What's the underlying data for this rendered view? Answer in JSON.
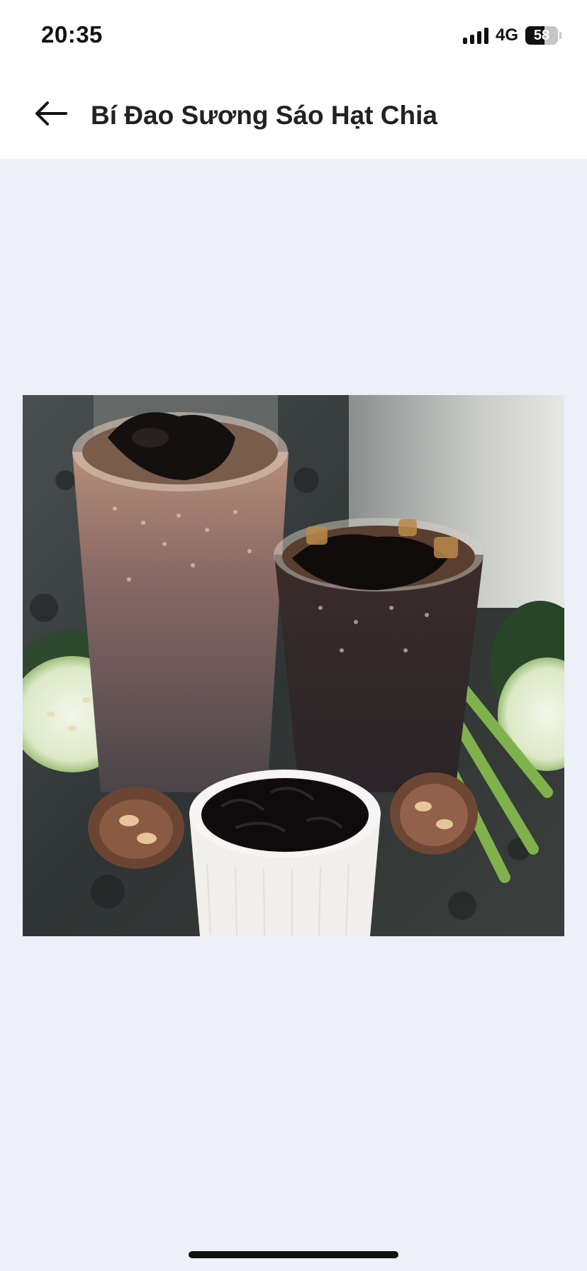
{
  "status_bar": {
    "time": "20:35",
    "network": "4G",
    "battery_level": "58",
    "battery_fraction": 0.58,
    "icons": [
      "signal-icon",
      "battery-icon"
    ]
  },
  "nav": {
    "back_icon": "arrow-left-icon",
    "title": "Bí Đao Sương Sáo Hạt Chia"
  },
  "content": {
    "image_subject": "product-photo"
  },
  "colors": {
    "page_background": "#edf0f8",
    "header_background": "#ffffff",
    "text_primary": "#222222"
  }
}
